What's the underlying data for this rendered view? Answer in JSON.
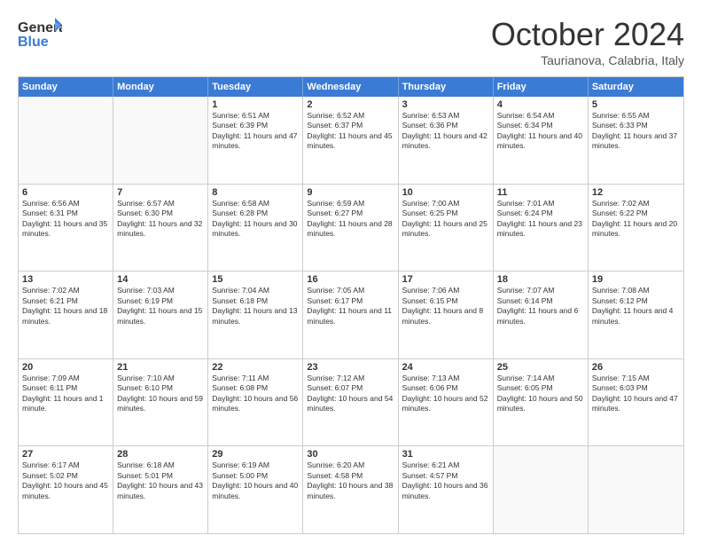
{
  "header": {
    "logo_general": "General",
    "logo_blue": "Blue",
    "month": "October 2024",
    "location": "Taurianova, Calabria, Italy"
  },
  "days_of_week": [
    "Sunday",
    "Monday",
    "Tuesday",
    "Wednesday",
    "Thursday",
    "Friday",
    "Saturday"
  ],
  "weeks": [
    [
      {
        "day": "",
        "sunrise": "",
        "sunset": "",
        "daylight": ""
      },
      {
        "day": "",
        "sunrise": "",
        "sunset": "",
        "daylight": ""
      },
      {
        "day": "1",
        "sunrise": "Sunrise: 6:51 AM",
        "sunset": "Sunset: 6:39 PM",
        "daylight": "Daylight: 11 hours and 47 minutes."
      },
      {
        "day": "2",
        "sunrise": "Sunrise: 6:52 AM",
        "sunset": "Sunset: 6:37 PM",
        "daylight": "Daylight: 11 hours and 45 minutes."
      },
      {
        "day": "3",
        "sunrise": "Sunrise: 6:53 AM",
        "sunset": "Sunset: 6:36 PM",
        "daylight": "Daylight: 11 hours and 42 minutes."
      },
      {
        "day": "4",
        "sunrise": "Sunrise: 6:54 AM",
        "sunset": "Sunset: 6:34 PM",
        "daylight": "Daylight: 11 hours and 40 minutes."
      },
      {
        "day": "5",
        "sunrise": "Sunrise: 6:55 AM",
        "sunset": "Sunset: 6:33 PM",
        "daylight": "Daylight: 11 hours and 37 minutes."
      }
    ],
    [
      {
        "day": "6",
        "sunrise": "Sunrise: 6:56 AM",
        "sunset": "Sunset: 6:31 PM",
        "daylight": "Daylight: 11 hours and 35 minutes."
      },
      {
        "day": "7",
        "sunrise": "Sunrise: 6:57 AM",
        "sunset": "Sunset: 6:30 PM",
        "daylight": "Daylight: 11 hours and 32 minutes."
      },
      {
        "day": "8",
        "sunrise": "Sunrise: 6:58 AM",
        "sunset": "Sunset: 6:28 PM",
        "daylight": "Daylight: 11 hours and 30 minutes."
      },
      {
        "day": "9",
        "sunrise": "Sunrise: 6:59 AM",
        "sunset": "Sunset: 6:27 PM",
        "daylight": "Daylight: 11 hours and 28 minutes."
      },
      {
        "day": "10",
        "sunrise": "Sunrise: 7:00 AM",
        "sunset": "Sunset: 6:25 PM",
        "daylight": "Daylight: 11 hours and 25 minutes."
      },
      {
        "day": "11",
        "sunrise": "Sunrise: 7:01 AM",
        "sunset": "Sunset: 6:24 PM",
        "daylight": "Daylight: 11 hours and 23 minutes."
      },
      {
        "day": "12",
        "sunrise": "Sunrise: 7:02 AM",
        "sunset": "Sunset: 6:22 PM",
        "daylight": "Daylight: 11 hours and 20 minutes."
      }
    ],
    [
      {
        "day": "13",
        "sunrise": "Sunrise: 7:02 AM",
        "sunset": "Sunset: 6:21 PM",
        "daylight": "Daylight: 11 hours and 18 minutes."
      },
      {
        "day": "14",
        "sunrise": "Sunrise: 7:03 AM",
        "sunset": "Sunset: 6:19 PM",
        "daylight": "Daylight: 11 hours and 15 minutes."
      },
      {
        "day": "15",
        "sunrise": "Sunrise: 7:04 AM",
        "sunset": "Sunset: 6:18 PM",
        "daylight": "Daylight: 11 hours and 13 minutes."
      },
      {
        "day": "16",
        "sunrise": "Sunrise: 7:05 AM",
        "sunset": "Sunset: 6:17 PM",
        "daylight": "Daylight: 11 hours and 11 minutes."
      },
      {
        "day": "17",
        "sunrise": "Sunrise: 7:06 AM",
        "sunset": "Sunset: 6:15 PM",
        "daylight": "Daylight: 11 hours and 8 minutes."
      },
      {
        "day": "18",
        "sunrise": "Sunrise: 7:07 AM",
        "sunset": "Sunset: 6:14 PM",
        "daylight": "Daylight: 11 hours and 6 minutes."
      },
      {
        "day": "19",
        "sunrise": "Sunrise: 7:08 AM",
        "sunset": "Sunset: 6:12 PM",
        "daylight": "Daylight: 11 hours and 4 minutes."
      }
    ],
    [
      {
        "day": "20",
        "sunrise": "Sunrise: 7:09 AM",
        "sunset": "Sunset: 6:11 PM",
        "daylight": "Daylight: 11 hours and 1 minute."
      },
      {
        "day": "21",
        "sunrise": "Sunrise: 7:10 AM",
        "sunset": "Sunset: 6:10 PM",
        "daylight": "Daylight: 10 hours and 59 minutes."
      },
      {
        "day": "22",
        "sunrise": "Sunrise: 7:11 AM",
        "sunset": "Sunset: 6:08 PM",
        "daylight": "Daylight: 10 hours and 56 minutes."
      },
      {
        "day": "23",
        "sunrise": "Sunrise: 7:12 AM",
        "sunset": "Sunset: 6:07 PM",
        "daylight": "Daylight: 10 hours and 54 minutes."
      },
      {
        "day": "24",
        "sunrise": "Sunrise: 7:13 AM",
        "sunset": "Sunset: 6:06 PM",
        "daylight": "Daylight: 10 hours and 52 minutes."
      },
      {
        "day": "25",
        "sunrise": "Sunrise: 7:14 AM",
        "sunset": "Sunset: 6:05 PM",
        "daylight": "Daylight: 10 hours and 50 minutes."
      },
      {
        "day": "26",
        "sunrise": "Sunrise: 7:15 AM",
        "sunset": "Sunset: 6:03 PM",
        "daylight": "Daylight: 10 hours and 47 minutes."
      }
    ],
    [
      {
        "day": "27",
        "sunrise": "Sunrise: 6:17 AM",
        "sunset": "Sunset: 5:02 PM",
        "daylight": "Daylight: 10 hours and 45 minutes."
      },
      {
        "day": "28",
        "sunrise": "Sunrise: 6:18 AM",
        "sunset": "Sunset: 5:01 PM",
        "daylight": "Daylight: 10 hours and 43 minutes."
      },
      {
        "day": "29",
        "sunrise": "Sunrise: 6:19 AM",
        "sunset": "Sunset: 5:00 PM",
        "daylight": "Daylight: 10 hours and 40 minutes."
      },
      {
        "day": "30",
        "sunrise": "Sunrise: 6:20 AM",
        "sunset": "Sunset: 4:58 PM",
        "daylight": "Daylight: 10 hours and 38 minutes."
      },
      {
        "day": "31",
        "sunrise": "Sunrise: 6:21 AM",
        "sunset": "Sunset: 4:57 PM",
        "daylight": "Daylight: 10 hours and 36 minutes."
      },
      {
        "day": "",
        "sunrise": "",
        "sunset": "",
        "daylight": ""
      },
      {
        "day": "",
        "sunrise": "",
        "sunset": "",
        "daylight": ""
      }
    ]
  ]
}
